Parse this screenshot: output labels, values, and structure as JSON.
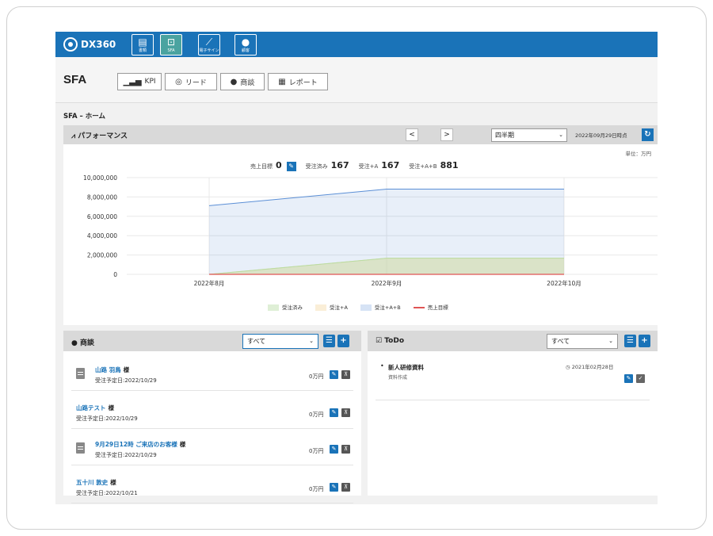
{
  "brand": {
    "name": "DX360"
  },
  "apps": [
    {
      "label": "書類",
      "icon": "document-icon"
    },
    {
      "label": "SFA",
      "icon": "chart-icon",
      "active": true
    },
    {
      "label": "電子サイン",
      "icon": "signature-icon"
    },
    {
      "label": "顧客",
      "icon": "person-icon"
    }
  ],
  "header": {
    "title": "SFA",
    "nav": [
      {
        "label": "KPI",
        "icon": "bar-chart-icon"
      },
      {
        "label": "リード",
        "icon": "lead-icon"
      },
      {
        "label": "商談",
        "icon": "person-icon"
      },
      {
        "label": "レポート",
        "icon": "report-icon"
      }
    ]
  },
  "breadcrumb": "SFA – ホーム",
  "performance": {
    "title": "パフォーマンス",
    "prev": "<",
    "next": ">",
    "period": "四半期",
    "as_of": "2022年09月29日時点",
    "unit": "単位：万円",
    "summary": {
      "target_label": "売上目標",
      "target_value": "0",
      "won_label": "受注済み",
      "won_value": "167",
      "a_label": "受注+A",
      "a_value": "167",
      "ab_label": "受注+A+B",
      "ab_value": "881"
    }
  },
  "chart_data": {
    "type": "area",
    "x": [
      "2022年8月",
      "2022年9月",
      "2022年10月"
    ],
    "yticks": [
      "10,000,000",
      "8,000,000",
      "6,000,000",
      "4,000,000",
      "2,000,000",
      "0"
    ],
    "ylim": [
      0,
      10000000
    ],
    "series": [
      {
        "name": "受注済み",
        "values": [
          0,
          1670000,
          1670000
        ],
        "color": "#b9dca3"
      },
      {
        "name": "受注+A",
        "values": [
          0,
          1670000,
          1670000
        ],
        "color": "#f3d9a6"
      },
      {
        "name": "受注+A+B",
        "values": [
          7100000,
          8810000,
          8810000
        ],
        "color": "#5b8fd6"
      },
      {
        "name": "売上目標",
        "values": [
          0,
          0,
          0
        ],
        "color": "#e05555"
      }
    ]
  },
  "deals": {
    "title": "商談",
    "filter": "すべて",
    "items": [
      {
        "name": "山路 羽鳥",
        "sama": "様",
        "due": "受注予定日:2022/10/29",
        "amount": "0万円",
        "has_doc": true
      },
      {
        "name": "山路テスト",
        "sama": "様",
        "due": "受注予定日:2022/10/29",
        "amount": "0万円",
        "has_doc": false
      },
      {
        "name": "9月29日12時 ご来店のお客様",
        "sama": "様",
        "due": "受注予定日:2022/10/29",
        "amount": "0万円",
        "has_doc": true
      },
      {
        "name": "五十川 敦史",
        "sama": "様",
        "due": "受注予定日:2022/10/21",
        "amount": "0万円",
        "has_doc": false
      }
    ]
  },
  "todo": {
    "title": "ToDo",
    "filter": "すべて",
    "items": [
      {
        "title": "新人研修資料",
        "sub": "資料作成",
        "date": "2021年02月28日"
      }
    ]
  }
}
